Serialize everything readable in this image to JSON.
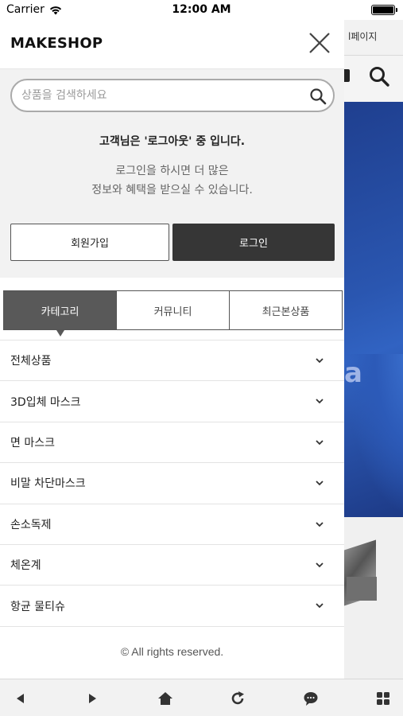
{
  "status_bar": {
    "carrier": "Carrier",
    "time": "12:00 AM",
    "wifi_icon": "wifi-icon",
    "battery_icon": "battery-icon"
  },
  "background_page": {
    "header_text": "l페이지",
    "banner_text": "a",
    "banner_color": "#2a56b0"
  },
  "drawer": {
    "logo": "MAKESHOP",
    "close_icon": "close-icon",
    "search": {
      "placeholder": "상품을 검색하세요",
      "value": "",
      "icon": "search-icon"
    },
    "notice": {
      "title": "고객님은 '로그아웃' 중 입니다.",
      "line1": "로그인을 하시면 더 많은",
      "line2": "정보와 혜택을 받으실 수 있습니다."
    },
    "buttons": {
      "join": "회원가입",
      "login": "로그인"
    },
    "tabs": [
      {
        "label": "카테고리",
        "active": true
      },
      {
        "label": "커뮤니티",
        "active": false
      },
      {
        "label": "최근본상품",
        "active": false
      }
    ],
    "categories": [
      "전체상품",
      "3D입체 마스크",
      "면 마스크",
      "비말 차단마스크",
      "손소독제",
      "체온계",
      "항균 물티슈"
    ],
    "copyright": "© All rights reserved."
  },
  "bottom_bar": {
    "icons": [
      "back-icon",
      "forward-icon",
      "home-icon",
      "refresh-icon",
      "chat-icon",
      "grid-menu-icon"
    ]
  },
  "colors": {
    "accent_dark": "#363636",
    "active_tab": "#595959",
    "panel_bg": "#f2f2f2"
  }
}
